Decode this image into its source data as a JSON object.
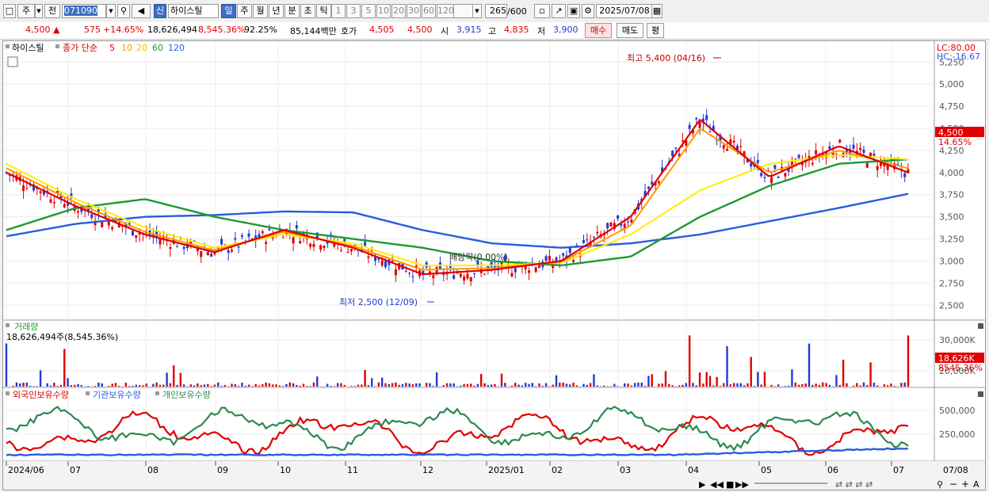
{
  "toolbar": {
    "market": "주",
    "prev": "전",
    "code": "071090",
    "new_badge": "신",
    "stock_name": "하이스틸",
    "periods": [
      "일",
      "주",
      "월",
      "년",
      "분",
      "초",
      "틱"
    ],
    "minute_options": [
      "1",
      "3",
      "5",
      "10",
      "20",
      "30",
      "60",
      "120"
    ],
    "count": "265",
    "count_total": "/600",
    "date": "2025/07/08"
  },
  "quote": {
    "price": "4,500",
    "change": "575",
    "change_pct": "+14.65%",
    "volume": "18,626,494",
    "volume_pct": "8,545.36%",
    "turnover_pct": "92.25%",
    "amount": "85,144백만",
    "quote_label": "호가",
    "bid": "4,505",
    "ask": "4,500",
    "open_label": "시",
    "open": "3,915",
    "high_label": "고",
    "high": "4,835",
    "low_label": "저",
    "low": "3,900",
    "buy_btn": "매수",
    "sell_btn": "매도",
    "eval_btn": "평"
  },
  "price_panel": {
    "name_label": "하이스틸",
    "ma_title": "종가 단순",
    "ma_periods": [
      "5",
      "10",
      "20",
      "60",
      "120"
    ],
    "lc_label": "LC:80.00",
    "hc_label": "HC:-16.67",
    "high_note": "최고 5,400 (04/16)",
    "low_note": "최저 2,500 (12/09)",
    "dividend_note": "배당락(0.00%)",
    "current_price_tag": "4,500",
    "current_pct_tag": "14.65%",
    "colors": {
      "ma5": "#e00000",
      "ma10": "#ff9900",
      "ma20": "#ffee00",
      "ma60": "#1e9a30",
      "ma120": "#2a5ce0",
      "up": "#e00000",
      "down": "#1e3cd8"
    }
  },
  "volume_panel": {
    "title": "거래량",
    "value_label": "18,626,494주(8,545.36%)",
    "current_tag": "18,626K",
    "current_pct_tag": "8545.36%"
  },
  "holdings_panel": {
    "legend": [
      "외국인보유수량",
      "기관보유수량",
      "개인보유수량"
    ],
    "colors": [
      "#e00000",
      "#2a5ce0",
      "#2a8a50"
    ]
  },
  "x_axis_labels": [
    "2024/06",
    "07",
    "08",
    "09",
    "10",
    "11",
    "12",
    "2025/01",
    "02",
    "03",
    "04",
    "05",
    "06",
    "07",
    "07/08"
  ],
  "chart_data": [
    {
      "type": "line",
      "title": "하이스틸 종가 단순 5 10 20 60 120",
      "ylim": [
        2350,
        5450
      ],
      "y_ticks": [
        2500,
        2750,
        3000,
        3250,
        3500,
        3750,
        4000,
        4250,
        4500,
        4750,
        5000,
        5250
      ],
      "x": [
        "2024/06",
        "07",
        "08",
        "09",
        "10",
        "11",
        "12",
        "2025/01",
        "02",
        "03",
        "04",
        "05",
        "06",
        "07"
      ],
      "series": [
        {
          "name": "5",
          "values": [
            4000,
            3620,
            3300,
            3100,
            3350,
            3150,
            2850,
            2900,
            3000,
            3500,
            4600,
            3950,
            4300,
            4000
          ]
        },
        {
          "name": "10",
          "values": [
            4050,
            3660,
            3330,
            3120,
            3330,
            3170,
            2900,
            2920,
            2990,
            3400,
            4500,
            4000,
            4250,
            4050
          ]
        },
        {
          "name": "20",
          "values": [
            4100,
            3700,
            3380,
            3150,
            3300,
            3200,
            2950,
            2950,
            2980,
            3300,
            3800,
            4100,
            4200,
            4150
          ]
        },
        {
          "name": "60",
          "values": [
            3350,
            3600,
            3700,
            3500,
            3350,
            3250,
            3150,
            3000,
            2950,
            3050,
            3500,
            3850,
            4100,
            4150
          ]
        },
        {
          "name": "120",
          "values": [
            3280,
            3420,
            3500,
            3520,
            3560,
            3550,
            3350,
            3200,
            3150,
            3200,
            3300,
            3450,
            3600,
            3760
          ]
        }
      ]
    },
    {
      "type": "bar",
      "title": "거래량",
      "y_ticks": [
        "30,000K",
        "20,000K"
      ],
      "note": "Spikes near 03 (~36,000K) and 04 (~30,000K); last day 18,626K"
    },
    {
      "type": "line",
      "title": "외국인보유수량 기관보유수량 개인보유수량",
      "y_ticks": [
        "500,000",
        "250,000"
      ],
      "series": [
        {
          "name": "외국인보유수량"
        },
        {
          "name": "기관보유수량"
        },
        {
          "name": "개인보유수량"
        }
      ]
    }
  ]
}
